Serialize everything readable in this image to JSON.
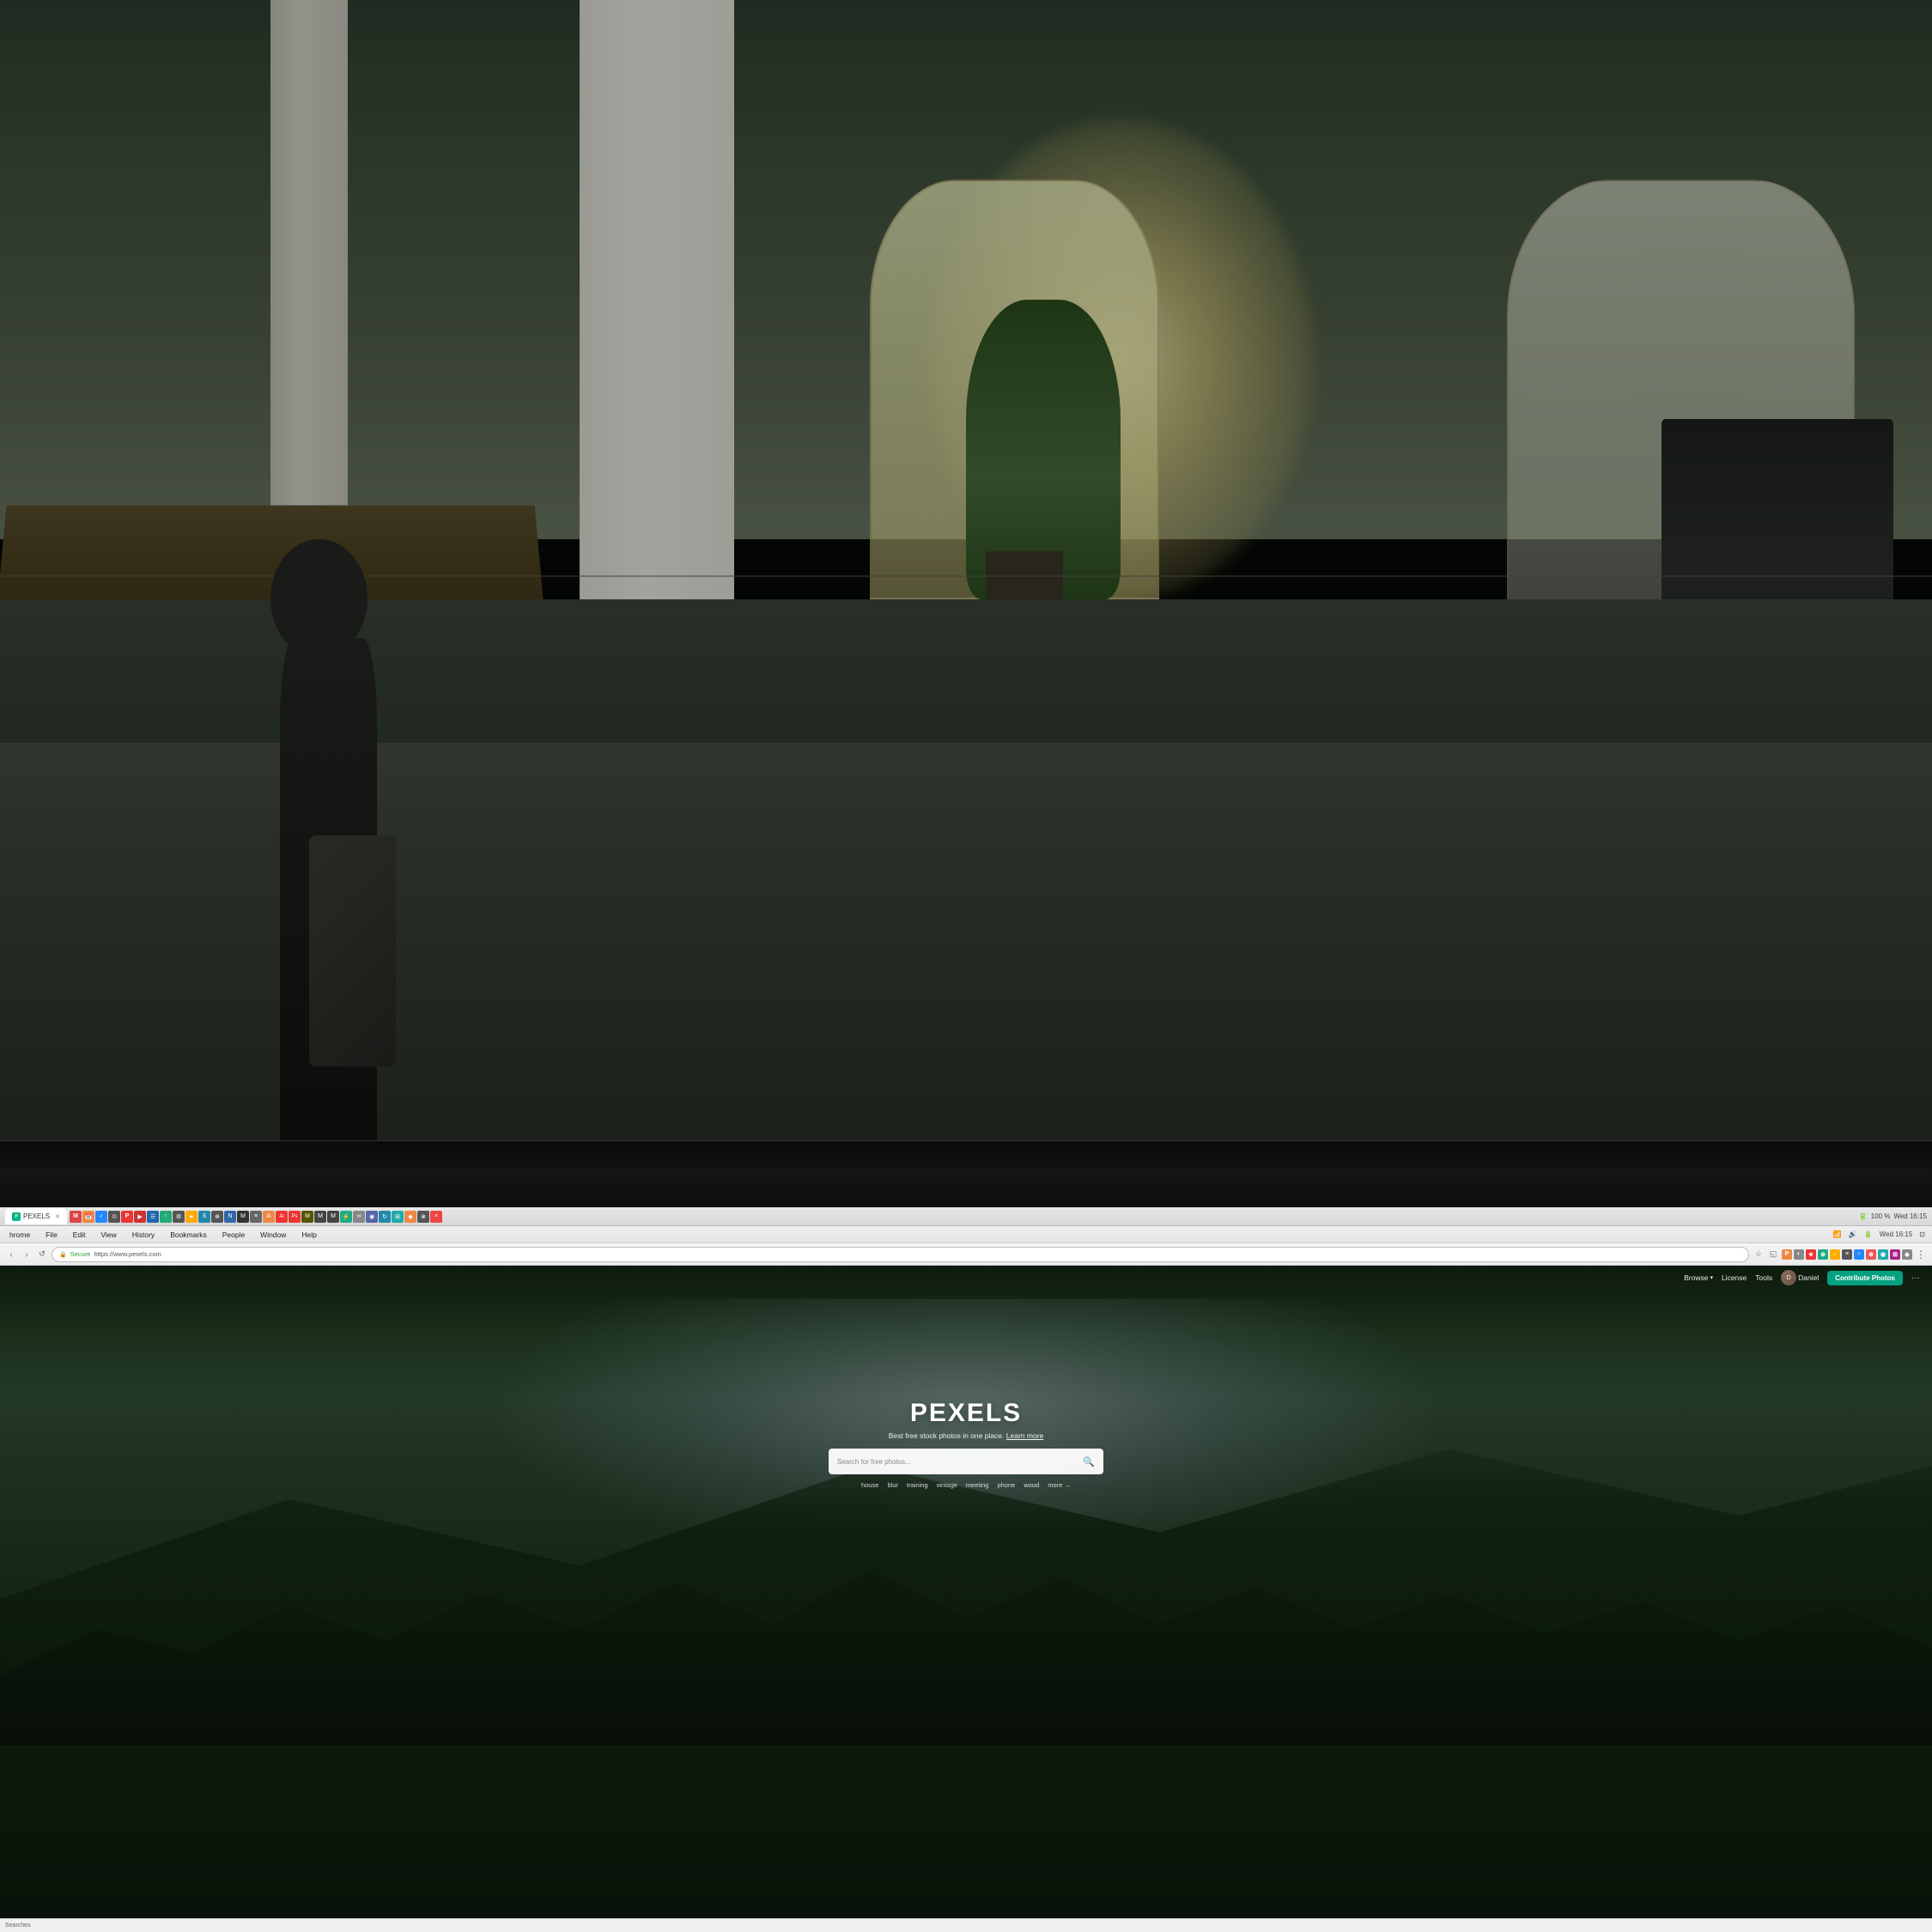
{
  "scene": {
    "background": "office",
    "description": "Blurred office background with monitor showing browser"
  },
  "monitor_bezel": {
    "color": "#111111"
  },
  "browser": {
    "tab_bar": {
      "active_tab": {
        "title": "Pexels",
        "favicon_color": "#05a081"
      }
    },
    "menu_bar": {
      "items": [
        "hrome",
        "File",
        "Edit",
        "View",
        "History",
        "Bookmarks",
        "People",
        "Window",
        "Help"
      ],
      "right": {
        "battery": "100 %",
        "time": "Wed 16:15"
      }
    },
    "address_bar": {
      "secure_label": "Secure",
      "url": "https://www.pexels.com",
      "bookmark_icon": "★",
      "refresh_icon": "↺"
    },
    "close_icon": "✕"
  },
  "pexels": {
    "nav": {
      "browse_label": "Browse",
      "browse_arrow": "▾",
      "license_label": "License",
      "tools_label": "Tools",
      "user_name": "Daniel",
      "contribute_button": "Contribute Photos",
      "more_dots": "···"
    },
    "hero": {
      "logo": "PEXELS",
      "tagline": "Best free stock photos in one place.",
      "tagline_link": "Learn more",
      "search_placeholder": "Search for free photos...",
      "search_icon": "🔍",
      "tags": [
        "house",
        "blur",
        "training",
        "vintage",
        "meeting",
        "phone",
        "wood"
      ],
      "more_label": "more →"
    }
  },
  "status_bar": {
    "left_text": "Searches"
  }
}
